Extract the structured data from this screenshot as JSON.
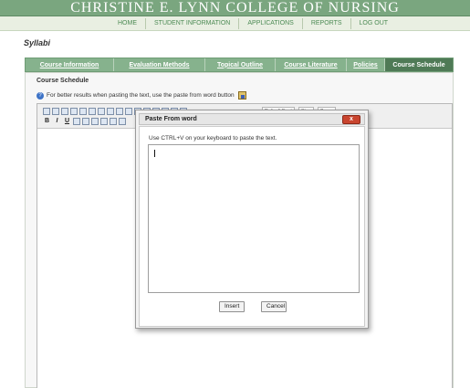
{
  "banner": {
    "title": "CHRISTINE E. LYNN COLLEGE OF NURSING"
  },
  "topnav": {
    "items": [
      "HOME",
      "STUDENT INFORMATION",
      "APPLICATIONS",
      "REPORTS",
      "LOG OUT"
    ]
  },
  "page": {
    "heading": "Syllabi"
  },
  "tabs": [
    {
      "label": "Course Information"
    },
    {
      "label": "Evaluation Methods"
    },
    {
      "label": "Topical Outline"
    },
    {
      "label": "Course Literature"
    },
    {
      "label": "Policies"
    },
    {
      "label": "Course Schedule",
      "active": true
    }
  ],
  "section": {
    "label": "Course Schedule",
    "tip": "For better results when pasting the text, use the paste from word button"
  },
  "editor": {
    "font_select": "Default Font",
    "size_select": "Size",
    "zoom_select": "Zoom",
    "format_letters": [
      "B",
      "I",
      "U"
    ]
  },
  "dialog": {
    "title": "Paste From word",
    "close_label": "x",
    "instruction": "Use CTRL+V on your keyboard to paste the text.",
    "paste_value": "",
    "insert_label": "Insert",
    "cancel_label": "Cancel"
  },
  "colors": {
    "banner": "#7aa67f",
    "tab_active": "#4f7a56",
    "tab_bar": "#86b28d",
    "close_button": "#c9452f"
  }
}
